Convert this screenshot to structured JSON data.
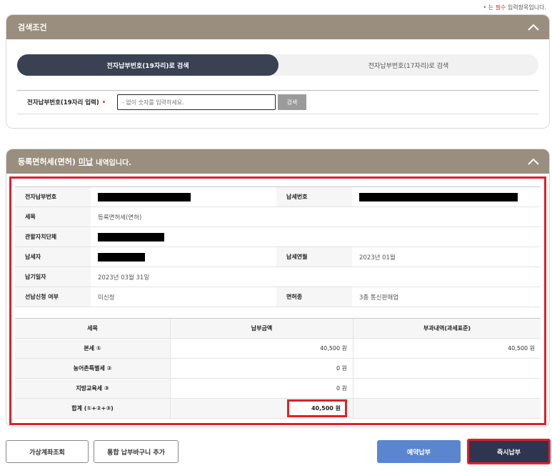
{
  "required_note": {
    "dot": "•",
    "prefix": "는 ",
    "required": "필수",
    "suffix": " 입력항목입니다."
  },
  "search_panel": {
    "title": "검색조건",
    "tabs": [
      {
        "label": "전자납부번호(19자리)로 검색",
        "active": true
      },
      {
        "label": "전자납부번호(17자리)로 검색",
        "active": false
      }
    ],
    "field_label": "전자납부번호(19자리 입력)",
    "required_mark": "•",
    "input_placeholder": "- 없이 숫자를 입력하세요.",
    "input_value": "",
    "search_button": "검색"
  },
  "result_panel": {
    "title_prefix": "등록면허세(면허)",
    "title_status": "미납",
    "title_suffix": "내역입니다.",
    "info": {
      "payment_number_label": "전자납부번호",
      "tax_number_label": "납세번호",
      "tax_item_label": "세목",
      "tax_item_value": "등록면허세(면허)",
      "jurisdiction_label": "관할자치단체",
      "taxpayer_label": "납세자",
      "tax_period_label": "납세연월",
      "tax_period_value": "2023년 01월",
      "due_date_label": "납기일자",
      "due_date_value": "2023년 03월 31일",
      "prepay_label": "선납신청 여부",
      "prepay_value": "미신청",
      "license_type_label": "면허종",
      "license_type_value": "3종 통신판매업"
    },
    "tax_table": {
      "headers": [
        "세목",
        "납부금액",
        "부과내역(과세표준)"
      ],
      "rows": [
        {
          "item": "본세 ①",
          "amount": "40,500 원",
          "base": "40,500 원"
        },
        {
          "item": "농어촌특별세 ②",
          "amount": "0 원",
          "base": ""
        },
        {
          "item": "지방교육세 ③",
          "amount": "0 원",
          "base": ""
        }
      ],
      "total": {
        "item": "합계 (①+②+③)",
        "amount": "40,500 원"
      }
    }
  },
  "buttons": {
    "virtual_account": "가상계좌조회",
    "add_cart": "통합 납부바구니 추가",
    "reserve_pay": "예약납부",
    "pay_now": "즉시납부"
  },
  "colors": {
    "panel_header": "#9a8e7e",
    "active_tab": "#3a4153",
    "highlight": "#e0202a",
    "reserve_button": "#5a86d0",
    "pay_now_button": "#2d3550"
  }
}
